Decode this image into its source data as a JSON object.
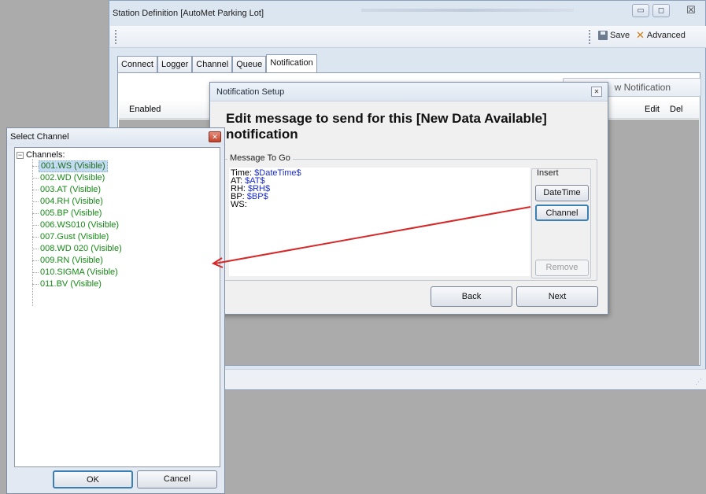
{
  "station_window": {
    "title": "Station Definition  [AutoMet Parking Lot]",
    "toolbar": {
      "save_label": "Save",
      "advanced_label": "Advanced"
    },
    "tabs": [
      {
        "label": "Connect",
        "active": false
      },
      {
        "label": "Logger",
        "active": false
      },
      {
        "label": "Channel",
        "active": false
      },
      {
        "label": "Queue",
        "active": false
      },
      {
        "label": "Notification",
        "active": true
      }
    ],
    "new_notification_label": "w Notification",
    "grid_headers": {
      "enabled": "Enabled",
      "edit": "Edit",
      "del": "Del"
    },
    "window_buttons": {
      "minimize": "▭",
      "restore": "◻",
      "close": "☒"
    }
  },
  "notification_dialog": {
    "title": "Notification Setup",
    "heading": "Edit message to send for this [New Data Available] notification",
    "message_group_label": "Message To Go",
    "message_lines": [
      {
        "label": "Time: ",
        "var": "$DateTime$"
      },
      {
        "label": "AT: ",
        "var": "$AT$"
      },
      {
        "label": "RH: ",
        "var": "$RH$"
      },
      {
        "label": "BP: ",
        "var": "$BP$"
      },
      {
        "label": "WS:",
        "var": ""
      }
    ],
    "insert_label": "Insert",
    "datetime_button": "DateTime",
    "channel_button": "Channel",
    "remove_button": "Remove",
    "back_button": "Back",
    "next_button": "Next"
  },
  "select_channel": {
    "title": "Select Channel",
    "root_label": "Channels:",
    "items": [
      {
        "label": "001.WS (Visible)",
        "selected": true
      },
      {
        "label": "002.WD (Visible)",
        "selected": false
      },
      {
        "label": "003.AT (Visible)",
        "selected": false
      },
      {
        "label": "004.RH (Visible)",
        "selected": false
      },
      {
        "label": "005.BP (Visible)",
        "selected": false
      },
      {
        "label": "006.WS010 (Visible)",
        "selected": false
      },
      {
        "label": "007.Gust (Visible)",
        "selected": false
      },
      {
        "label": "008.WD 020 (Visible)",
        "selected": false
      },
      {
        "label": "009.RN (Visible)",
        "selected": false
      },
      {
        "label": "010.SIGMA (Visible)",
        "selected": false
      },
      {
        "label": "011.BV (Visible)",
        "selected": false
      }
    ],
    "ok_button": "OK",
    "cancel_button": "Cancel"
  },
  "colors": {
    "tree_text": "#148a14",
    "variable_text": "#1a2dd6",
    "annotation_arrow": "#d62828"
  }
}
